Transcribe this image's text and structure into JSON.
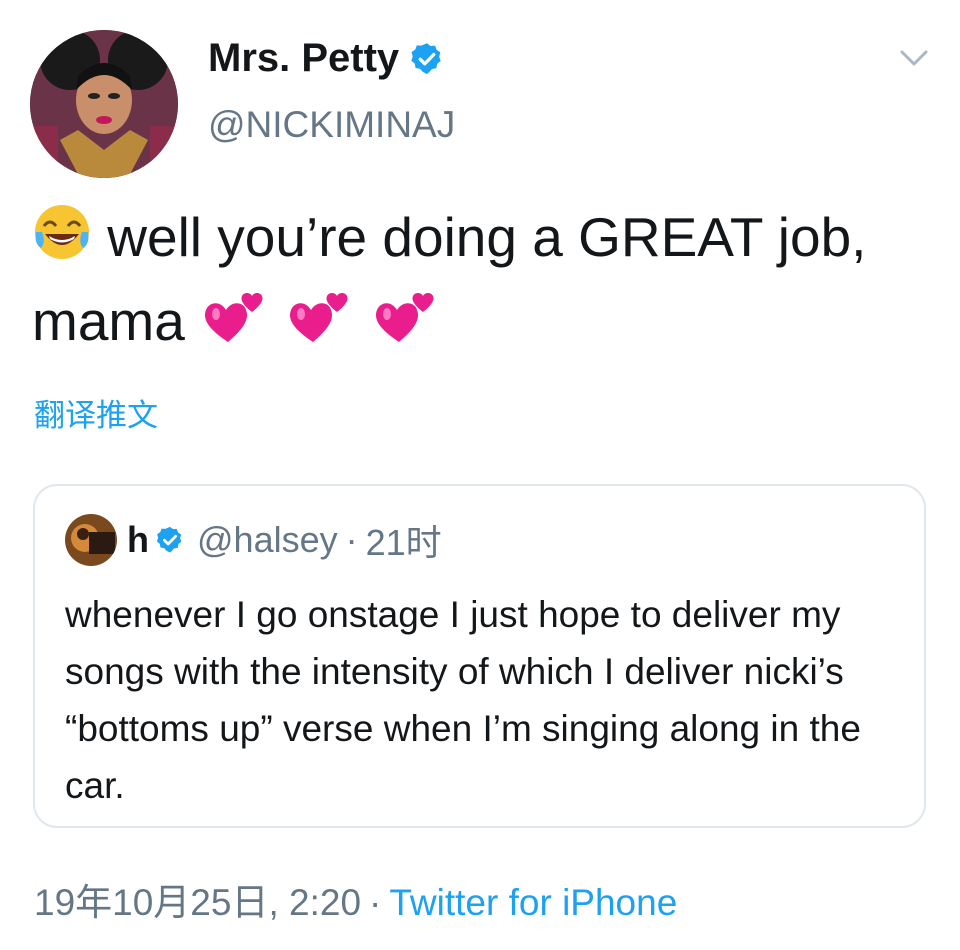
{
  "tweet": {
    "display_name": "Mrs. Petty",
    "handle": "@NICKIMINAJ",
    "text_main": "well you’re doing a GREAT job, mama",
    "translate_label": "翻译推文",
    "icons": {
      "avatar": "avatar-image",
      "verified": "verified-badge-icon",
      "menu": "chevron-down-icon",
      "emoji_leading": "face-with-tears-of-joy-emoji",
      "emoji_trailing": "two-hearts-emoji"
    }
  },
  "quote": {
    "display_name": "h",
    "handle": "@halsey",
    "separator": "·",
    "time": "21时",
    "text": "whenever I go onstage I just hope to deliver my songs with the intensity of which I deliver nicki’s “bottoms up” verse when I’m singing along in the car."
  },
  "footer": {
    "timestamp": "19年10月25日, 2:20",
    "separator": "·",
    "source": "Twitter for iPhone"
  },
  "colors": {
    "link": "#1da1f2",
    "text": "#14171a",
    "secondary": "#657786",
    "border": "#e1e8ed",
    "heart": "#e91e8c"
  }
}
